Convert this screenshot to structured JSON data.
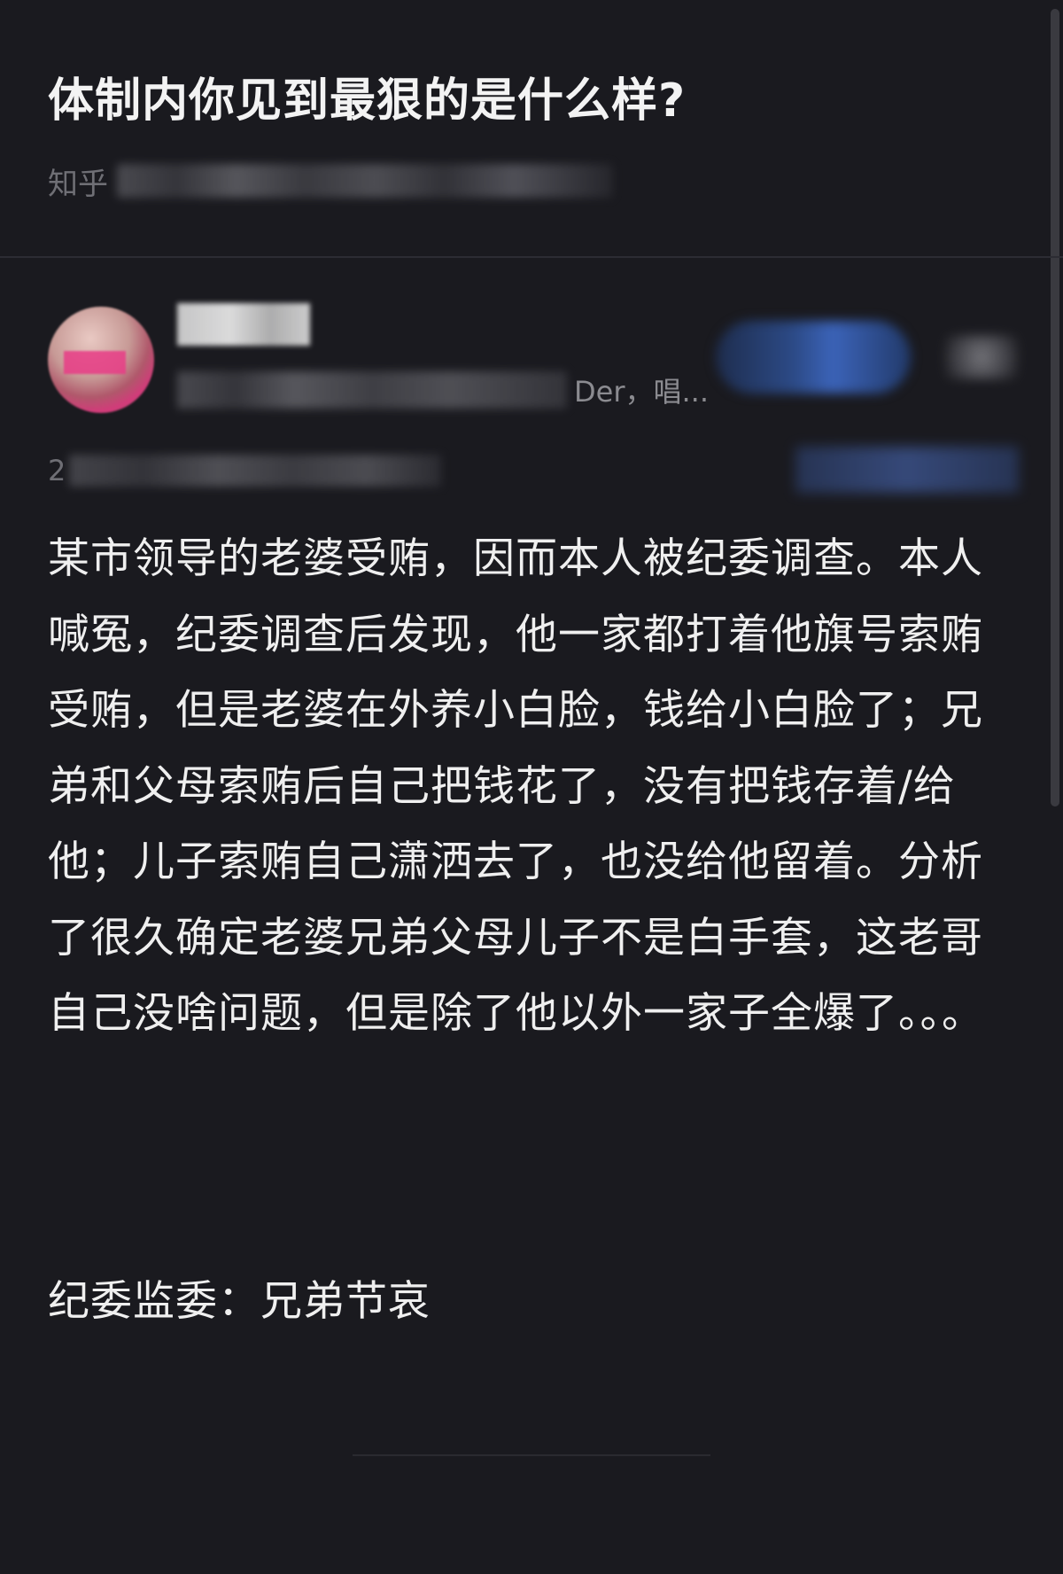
{
  "question": {
    "title": "体制内你见到最狠的是什么样?",
    "meta_prefix": "知乎"
  },
  "author": {
    "bio_visible_suffix": "Der，唱..."
  },
  "answer": {
    "date_prefix": "2",
    "body": "某市领导的老婆受贿，因而本人被纪委调查。本人喊冤，纪委调查后发现，他一家都打着他旗号索贿受贿，但是老婆在外养小白脸，钱给小白脸了；兄弟和父母索贿后自己把钱花了，没有把钱存着/给他；儿子索贿自己潇洒去了，也没给他留着。分析了很久确定老婆兄弟父母儿子不是白手套，这老哥自己没啥问题，但是除了他以外一家子全爆了。。。",
    "footer_line": "纪委监委：兄弟节哀"
  }
}
